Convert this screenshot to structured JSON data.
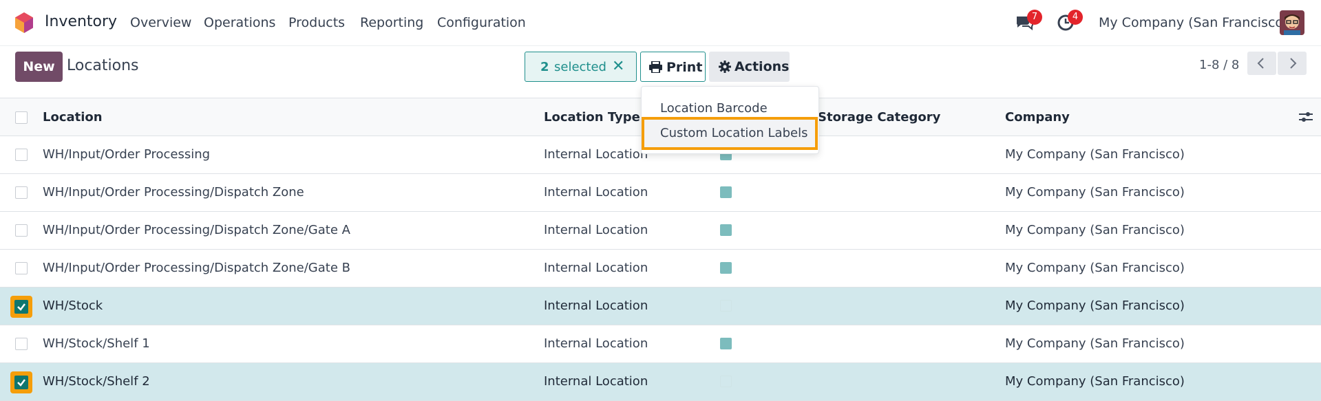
{
  "navbar": {
    "app_name": "Inventory",
    "menu": [
      "Overview",
      "Operations",
      "Products",
      "Reporting",
      "Configuration"
    ],
    "messages_count": "7",
    "activities_count": "4",
    "company": "My Company (San Francisco)"
  },
  "control": {
    "new_label": "New",
    "title": "Locations",
    "selected_count": "2",
    "selected_text": "selected",
    "print_label": "Print",
    "actions_label": "Actions",
    "pager": "1-8 / 8"
  },
  "print_menu": {
    "items": [
      "Location Barcode",
      "Custom Location Labels"
    ]
  },
  "table": {
    "columns": [
      "Location",
      "Location Type",
      "Storage Category",
      "Company"
    ],
    "rows": [
      {
        "location": "WH/Input/Order Processing",
        "type": "Internal Location",
        "scrap": true,
        "company": "My Company (San Francisco)",
        "selected": false
      },
      {
        "location": "WH/Input/Order Processing/Dispatch Zone",
        "type": "Internal Location",
        "scrap": true,
        "company": "My Company (San Francisco)",
        "selected": false
      },
      {
        "location": "WH/Input/Order Processing/Dispatch Zone/Gate A",
        "type": "Internal Location",
        "scrap": true,
        "company": "My Company (San Francisco)",
        "selected": false
      },
      {
        "location": "WH/Input/Order Processing/Dispatch Zone/Gate B",
        "type": "Internal Location",
        "scrap": true,
        "company": "My Company (San Francisco)",
        "selected": false
      },
      {
        "location": "WH/Stock",
        "type": "Internal Location",
        "scrap": false,
        "company": "My Company (San Francisco)",
        "selected": true
      },
      {
        "location": "WH/Stock/Shelf 1",
        "type": "Internal Location",
        "scrap": true,
        "company": "My Company (San Francisco)",
        "selected": false
      },
      {
        "location": "WH/Stock/Shelf 2",
        "type": "Internal Location",
        "scrap": false,
        "company": "My Company (San Francisco)",
        "selected": true
      }
    ]
  },
  "colors": {
    "brand": "#714b67",
    "accent": "#1f8f8c",
    "highlight": "#f59e0b",
    "selected_row": "#d2e8ec"
  }
}
